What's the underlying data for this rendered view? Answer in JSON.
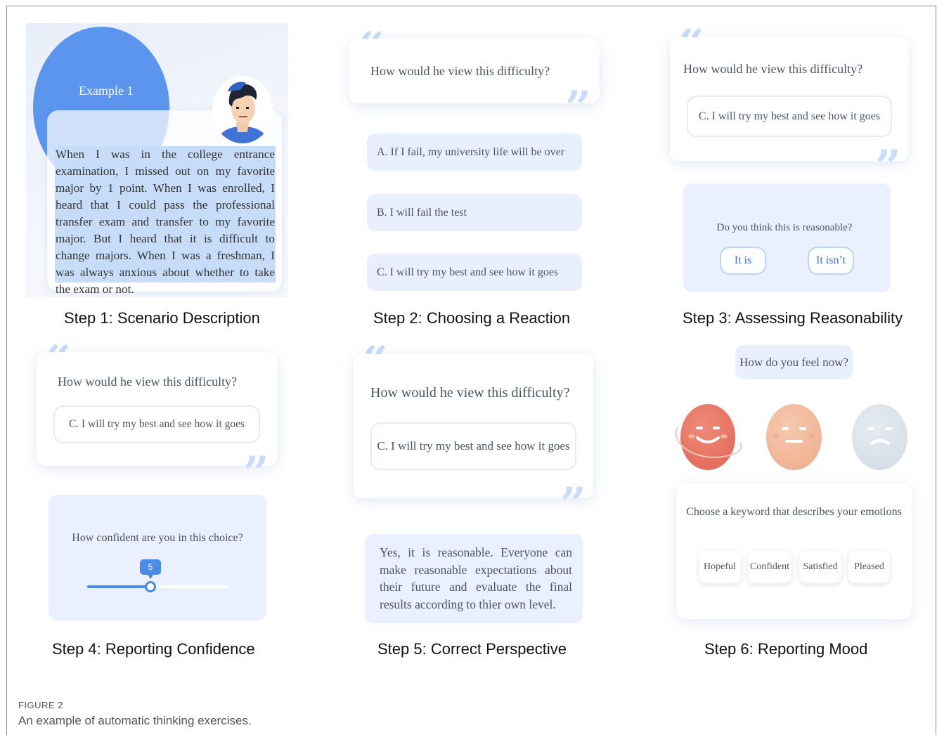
{
  "step1": {
    "example_title": "Example 1",
    "scenario_text": "When I was in the college entrance examination, I missed out on my favorite major by 1 point. When I was enrolled, I heard that I could pass the professional transfer exam and transfer to my favorite major. But I heard that it is difficult to change majors. When I was a freshman, I was always anxious about whether to take the exam or not.",
    "label": "Step 1: Scenario Description"
  },
  "step2": {
    "question": "How would he view this difficulty?",
    "options": [
      "A. If I fail, my university life will be over",
      "B. I will fail the test",
      "C. I will try my best and see how it goes"
    ],
    "label": "Step 2: Choosing a Reaction"
  },
  "step3": {
    "question": "How would he view this difficulty?",
    "selected_answer": "C. I will try my best and see how it goes",
    "prompt": "Do you think this is reasonable?",
    "yes_label": "It is",
    "no_label": "It isn’t",
    "label": "Step 3: Assessing Reasonability"
  },
  "step4": {
    "question": "How would he view this difficulty?",
    "selected_answer": "C. I will try my best and see how it goes",
    "prompt": "How confident are you in this choice?",
    "slider_value": "5",
    "slider_fraction": 0.45,
    "label": "Step 4: Reporting Confidence"
  },
  "step5": {
    "question": "How would he view this difficulty?",
    "selected_answer": "C. I will try my best and see how it goes",
    "feedback": "Yes, it is reasonable. Everyone can make reasonable expectations about their future and evaluate the final results according to thier own level.",
    "label": "Step 5: Correct Perspective"
  },
  "step6": {
    "question": "How do you feel now?",
    "faces": [
      "happy-face",
      "neutral-face",
      "sad-face"
    ],
    "keyword_prompt": "Choose a keyword that describes your emotions",
    "keywords": [
      "Hopeful",
      "Confident",
      "Satisfied",
      "Pleased"
    ],
    "label": "Step 6: Reporting Mood"
  },
  "figure": {
    "number": "FIGURE 2",
    "caption": "An example of automatic thinking exercises."
  },
  "colors": {
    "accent": "#5b95ee",
    "panel_bg": "#eaf0fd",
    "highlight": "#c7dcf8",
    "quote": "#c9dcfa"
  }
}
